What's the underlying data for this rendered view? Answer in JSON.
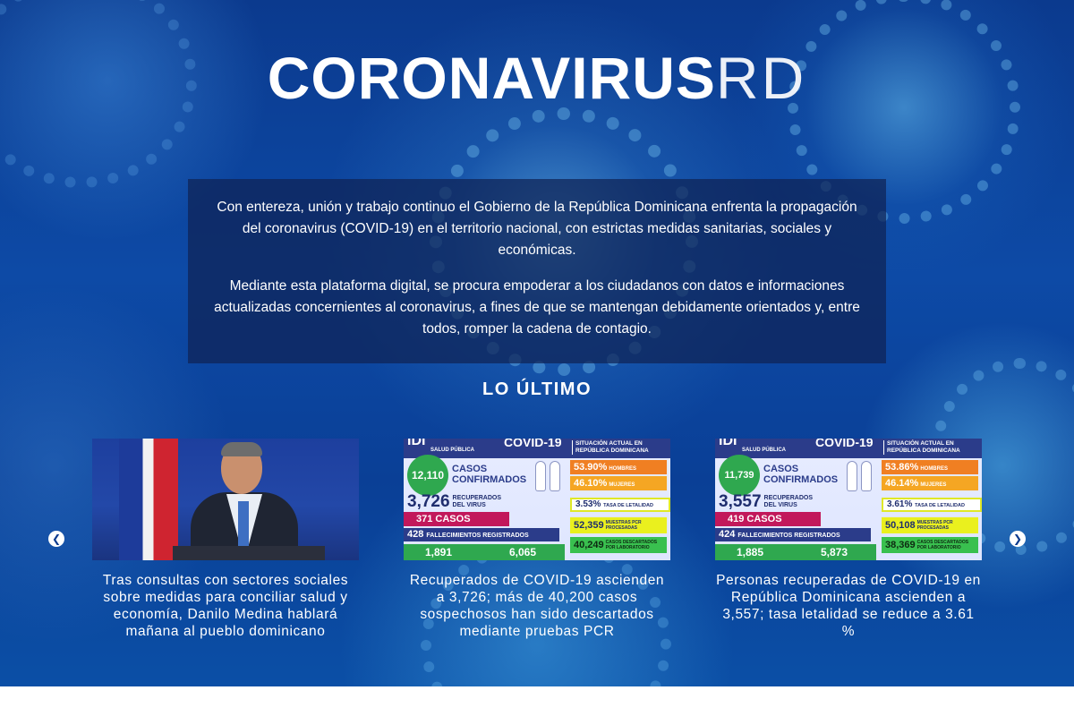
{
  "hero": {
    "title_strong": "CORONAVIRUS",
    "title_light": "RD",
    "intro_paragraphs": [
      "Con entereza, unión y trabajo continuo el Gobierno de la República Dominicana enfrenta la propagación del coronavirus (COVID-19) en el territorio nacional, con estrictas medidas sanitarias, sociales y económicas.",
      "Mediante esta plataforma digital, se procura empoderar a los ciudadanos con datos e informaciones actualizadas concernientes al coronavirus, a fines de que se mantengan debidamente orientados y, entre todos, romper la cadena de contagio."
    ]
  },
  "latest": {
    "heading": "LO ÚLTIMO",
    "prev_icon": "chevron-left-icon",
    "next_icon": "chevron-right-icon",
    "prev_glyph": "❮",
    "next_glyph": "❯",
    "cards": [
      {
        "caption": "Tras consultas con sectores sociales sobre medidas para conciliar salud y economía, Danilo Medina hablará mañana al pueblo dominicano"
      },
      {
        "caption": "Recuperados de COVID-19 ascienden a 3,726; más de 40,200 casos sospechosos han sido descartados mediante pruebas PCR",
        "info": {
          "brand": "IDI",
          "brand_sub": "SALUD PÚBLICA",
          "covid": "COVID-19",
          "situation": "SITUACIÓN ACTUAL EN REPÚBLICA DOMINICANA",
          "confirmed": "12,110",
          "confirmed_label": "CASOS CONFIRMADOS",
          "men_pct": "53.90%",
          "men_label": "HOMBRES",
          "women_pct": "46.10%",
          "women_label": "MUJERES",
          "recovered": "3,726",
          "recovered_label": "RECUPERADOS DEL VIRUS",
          "lethality": "3.53%",
          "lethality_label": "TASA DE LETALIDAD",
          "new_cases": "371",
          "new_cases_label": "CASOS NUEVOS",
          "deaths": "428",
          "deaths_label": "FALLECIMIENTOS REGISTRADOS",
          "pcr": "52,359",
          "pcr_label": "MUESTRAS PCR PROCESADAS",
          "discarded": "40,249",
          "discarded_label": "CASOS DESCARTADOS POR LABORATORIO",
          "bottom_a": "1,891",
          "bottom_b": "6,065"
        }
      },
      {
        "caption": "Personas recuperadas de COVID-19 en República Dominicana ascienden a 3,557; tasa letalidad se reduce a 3.61 %",
        "info": {
          "brand": "IDI",
          "brand_sub": "SALUD PÚBLICA",
          "covid": "COVID-19",
          "situation": "SITUACIÓN ACTUAL EN REPÚBLICA DOMINICANA",
          "confirmed": "11,739",
          "confirmed_label": "CASOS CONFIRMADOS",
          "men_pct": "53.86%",
          "men_label": "HOMBRES",
          "women_pct": "46.14%",
          "women_label": "MUJERES",
          "recovered": "3,557",
          "recovered_label": "RECUPERADOS DEL VIRUS",
          "lethality": "3.61%",
          "lethality_label": "TASA DE LETALIDAD",
          "new_cases": "419",
          "new_cases_label": "CASOS NUEVOS",
          "deaths": "424",
          "deaths_label": "FALLECIMIENTOS REGISTRADOS",
          "pcr": "50,108",
          "pcr_label": "MUESTRAS PCR PROCESADAS",
          "discarded": "38,369",
          "discarded_label": "CASOS DESCARTADOS POR LABORATORIO",
          "bottom_a": "1,885",
          "bottom_b": "5,873"
        }
      }
    ]
  },
  "colors": {
    "background": "#0b3a8e",
    "intro_panel": "#0f2355",
    "text": "#ffffff"
  }
}
